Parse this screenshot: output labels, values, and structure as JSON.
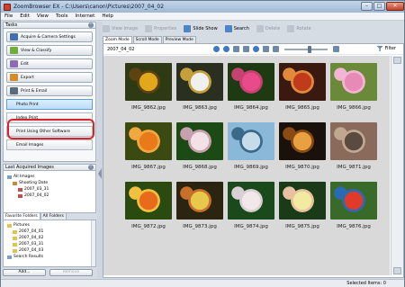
{
  "window": {
    "title": "ZoomBrowser EX  -  C:\\Users\\canon\\Pictures\\2007_04_02",
    "controls": [
      "–",
      "□",
      "✕"
    ]
  },
  "menu": [
    "File",
    "Edit",
    "View",
    "Tools",
    "Internet",
    "Help"
  ],
  "tasks": {
    "header": "Tasks",
    "buttons": [
      {
        "label": "Acquire & Camera Settings",
        "icon": "camera-icon",
        "color": "#3f6fb0"
      },
      {
        "label": "View & Classify",
        "icon": "classify-icon",
        "color": "#6fae3b"
      },
      {
        "label": "Edit",
        "icon": "edit-icon",
        "color": "#8c6bb8"
      },
      {
        "label": "Export",
        "icon": "export-icon",
        "color": "#d98a28"
      },
      {
        "label": "Print & Email",
        "icon": "printer-icon",
        "color": "#5a6b80"
      }
    ],
    "subitems": [
      "Photo Print",
      "Index Print",
      "Print Using Other Software",
      "Email Images"
    ]
  },
  "last_acquired": {
    "header": "Last Acquired Images",
    "tree": [
      "All Images",
      "Shooting Date",
      "2007_03_31",
      "2007_04_02"
    ]
  },
  "favorites": {
    "tabs": [
      "Favorite Folders",
      "All Folders"
    ],
    "tree": [
      "Pictures",
      "2007_04_01",
      "2007_04_02",
      "2007_03_31",
      "2007_04_03",
      "Search Results"
    ],
    "add_label": "Add...",
    "remove_label": "Remove"
  },
  "toolbar": [
    {
      "label": "View Image",
      "enabled": false
    },
    {
      "label": "Properties",
      "enabled": false
    },
    {
      "label": "Slide Show",
      "enabled": true
    },
    {
      "label": "Search",
      "enabled": true
    },
    {
      "label": "Delete",
      "enabled": false
    },
    {
      "label": "Rotate",
      "enabled": false
    }
  ],
  "mode_tabs": [
    "Zoom Mode",
    "Scroll Mode",
    "Preview Mode"
  ],
  "current_folder": "2007_04_02",
  "filter_label": "Filter",
  "thumbnails": [
    {
      "name": "IMG_9862.jpg",
      "colors": [
        "#2d3a14",
        "#e0a81a",
        "#5d4212"
      ]
    },
    {
      "name": "IMG_9863.jpg",
      "colors": [
        "#2a3020",
        "#f0f0ee",
        "#c5a03a"
      ]
    },
    {
      "name": "IMG_9864.jpg",
      "colors": [
        "#1e3a12",
        "#e84a8a",
        "#c64270"
      ]
    },
    {
      "name": "IMG_9865.jpg",
      "colors": [
        "#3a1a10",
        "#c23a1c",
        "#e08a3a"
      ]
    },
    {
      "name": "IMG_9866.jpg",
      "colors": [
        "#6a8a3a",
        "#e88ab8",
        "#f2b6d4"
      ]
    },
    {
      "name": "IMG_9867.jpg",
      "colors": [
        "#3a4a10",
        "#e87a1a",
        "#f2a840"
      ]
    },
    {
      "name": "IMG_9868.jpg",
      "colors": [
        "#1c4a14",
        "#f2e2e6",
        "#c8a0b0"
      ]
    },
    {
      "name": "IMG_9869.jpg",
      "colors": [
        "#8ab8d8",
        "#c6dcea",
        "#3a6a8a"
      ]
    },
    {
      "name": "IMG_9870.jpg",
      "colors": [
        "#1a120a",
        "#e8a040",
        "#8a4a14"
      ]
    },
    {
      "name": "IMG_9871.jpg",
      "colors": [
        "#8a6a5a",
        "#5a4a40",
        "#c0a890"
      ]
    },
    {
      "name": "IMG_9872.jpg",
      "colors": [
        "#2a4a10",
        "#e86a1a",
        "#f2c040"
      ]
    },
    {
      "name": "IMG_9873.jpg",
      "colors": [
        "#2a2410",
        "#e8c84a",
        "#c8702a"
      ]
    },
    {
      "name": "IMG_9874.jpg",
      "colors": [
        "#1a4a1c",
        "#f2e8ea",
        "#d8d0d4"
      ]
    },
    {
      "name": "IMG_9875.jpg",
      "colors": [
        "#1a3a18",
        "#f2eaa0",
        "#e8c2a0"
      ]
    },
    {
      "name": "IMG_9876.jpg",
      "colors": [
        "#3a6a2a",
        "#e03a2a",
        "#2a6ab0"
      ]
    }
  ],
  "status": {
    "selected": "Selected Items: 0"
  },
  "accent": "#d9252a"
}
